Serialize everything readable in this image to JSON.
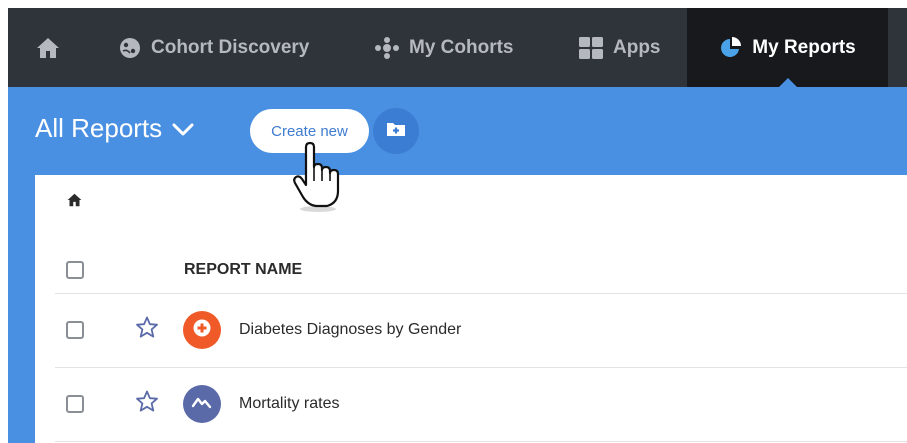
{
  "nav": {
    "items": [
      {
        "label": "",
        "icon": "home-icon"
      },
      {
        "label": "Cohort Discovery",
        "icon": "brain-icon"
      },
      {
        "label": "My Cohorts",
        "icon": "network-icon"
      },
      {
        "label": "Apps",
        "icon": "grid-icon"
      },
      {
        "label": "My Reports",
        "icon": "pie-chart-icon",
        "active": true
      }
    ]
  },
  "header": {
    "title": "All Reports",
    "create_label": "Create new",
    "folder_icon": "add-folder-icon"
  },
  "breadcrumb": {
    "icon": "home-icon"
  },
  "table": {
    "column_header": "REPORT NAME",
    "rows": [
      {
        "name": "Diabetes Diagnoses by Gender",
        "icon": "plus-circle-icon",
        "icon_color": "#f05a28"
      },
      {
        "name": "Mortality rates",
        "icon": "trend-line-icon",
        "icon_color": "#5a6aa8"
      }
    ]
  },
  "colors": {
    "nav_bg": "#2f333a",
    "nav_active_bg": "#17191d",
    "header_blue": "#4a90e2"
  }
}
